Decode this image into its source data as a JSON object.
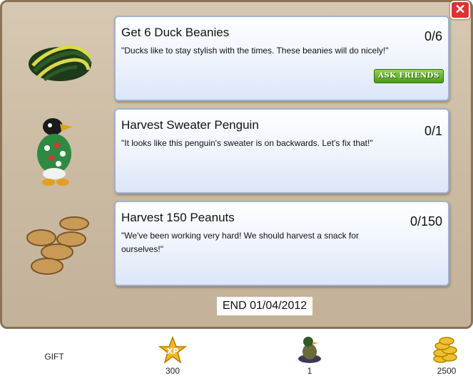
{
  "close_label": "✕",
  "tasks": [
    {
      "title": "Get 6 Duck Beanies",
      "description": "\"Ducks like to stay stylish with the times. These beanies will do nicely!\"",
      "progress": "0/6",
      "ask_label": "ASK FRIENDS",
      "icon": "duck-beanie-icon"
    },
    {
      "title": "Harvest Sweater Penguin",
      "description": "\"It looks like this penguin's sweater is on backwards. Let's fix that!\"",
      "progress": "0/1",
      "icon": "sweater-penguin-icon"
    },
    {
      "title": "Harvest 150 Peanuts",
      "description": "\"We've been working very hard! We should harvest a snack for ourselves!\"",
      "progress": "0/150",
      "icon": "peanuts-icon"
    }
  ],
  "end_date": "END 01/04/2012",
  "rewards": {
    "gift_label": "GIFT",
    "xp_icon_text": "XP",
    "xp_value": "300",
    "duck_value": "1",
    "coins_value": "2500"
  },
  "colors": {
    "accent_green": "#4a9a1a",
    "close_red": "#d33"
  }
}
